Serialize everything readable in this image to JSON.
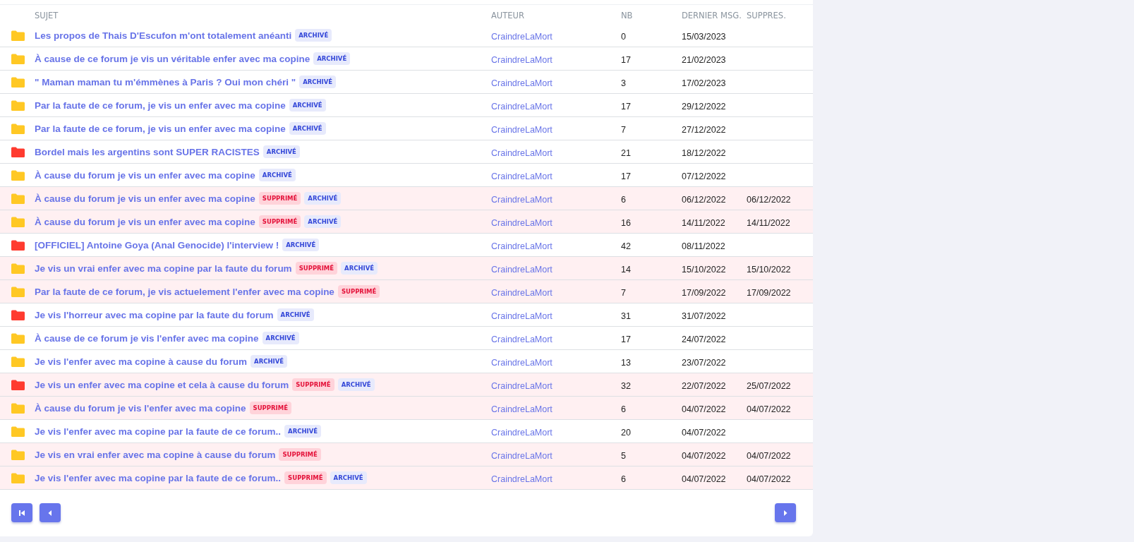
{
  "table": {
    "columns": [
      "SUJET",
      "AUTEUR",
      "NB",
      "DERNIER MSG.",
      "SUPPRES."
    ],
    "rows": [
      {
        "color": "#ffc824",
        "subject": "Les propos de Thais D'Escufon m'ont totalement anéanti",
        "deleted": false,
        "tags": [
          {
            "label": "ARCHIVÉ",
            "kind": "archived"
          }
        ],
        "author": "CraindreLaMort",
        "nb": "0",
        "last": "15/03/2023"
      },
      {
        "color": "#ffc824",
        "subject": "À cause de ce forum je vis un véritable enfer avec ma copine",
        "deleted": false,
        "tags": [
          {
            "label": "ARCHIVÉ",
            "kind": "archived"
          }
        ],
        "author": "CraindreLaMort",
        "nb": "17",
        "last": "21/02/2023"
      },
      {
        "color": "#ffc824",
        "subject": "\" Maman maman tu m'émmènes à Paris ? Oui mon chéri \"",
        "deleted": false,
        "tags": [
          {
            "label": "ARCHIVÉ",
            "kind": "archived"
          }
        ],
        "author": "CraindreLaMort",
        "nb": "3",
        "last": "17/02/2023"
      },
      {
        "color": "#ffc824",
        "subject": "Par la faute de ce forum, je vis un enfer avec ma copine",
        "deleted": false,
        "tags": [
          {
            "label": "ARCHIVÉ",
            "kind": "archived"
          }
        ],
        "author": "CraindreLaMort",
        "nb": "17",
        "last": "29/12/2022"
      },
      {
        "color": "#ffc824",
        "subject": "Par la faute de ce forum, je vis un enfer avec ma copine",
        "deleted": false,
        "tags": [
          {
            "label": "ARCHIVÉ",
            "kind": "archived"
          }
        ],
        "author": "CraindreLaMort",
        "nb": "7",
        "last": "27/12/2022"
      },
      {
        "color": "#ff3b2f",
        "subject": "Bordel mais les argentins sont SUPER RACISTES",
        "deleted": false,
        "tags": [
          {
            "label": "ARCHIVÉ",
            "kind": "archived"
          }
        ],
        "author": "CraindreLaMort",
        "nb": "21",
        "last": "18/12/2022"
      },
      {
        "color": "#ffc824",
        "subject": "À cause du forum je vis un enfer avec ma copine",
        "deleted": false,
        "tags": [
          {
            "label": "ARCHIVÉ",
            "kind": "archived"
          }
        ],
        "author": "CraindreLaMort",
        "nb": "17",
        "last": "07/12/2022"
      },
      {
        "color": "#ffc824",
        "subject": "À cause du forum je vis un enfer avec ma copine",
        "deleted": true,
        "tags": [
          {
            "label": "SUPPRIMÉ",
            "kind": "deleted"
          },
          {
            "label": "ARCHIVÉ",
            "kind": "archived"
          }
        ],
        "author": "CraindreLaMort",
        "nb": "6",
        "last": "06/12/2022",
        "deleted_on": "06/12/2022"
      },
      {
        "color": "#ffc824",
        "subject": "À cause du forum je vis un enfer avec ma copine",
        "deleted": true,
        "tags": [
          {
            "label": "SUPPRIMÉ",
            "kind": "deleted"
          },
          {
            "label": "ARCHIVÉ",
            "kind": "archived"
          }
        ],
        "author": "CraindreLaMort",
        "nb": "16",
        "last": "14/11/2022",
        "deleted_on": "14/11/2022"
      },
      {
        "color": "#ff3b2f",
        "subject": "[OFFICIEL] Antoine Goya (Anal Genocide) l'interview !",
        "deleted": false,
        "tags": [
          {
            "label": "ARCHIVÉ",
            "kind": "archived"
          }
        ],
        "author": "CraindreLaMort",
        "nb": "42",
        "last": "08/11/2022"
      },
      {
        "color": "#ffc824",
        "subject": "Je vis un vrai enfer avec ma copine par la faute du forum",
        "deleted": true,
        "tags": [
          {
            "label": "SUPPRIMÉ",
            "kind": "deleted"
          },
          {
            "label": "ARCHIVÉ",
            "kind": "archived"
          }
        ],
        "author": "CraindreLaMort",
        "nb": "14",
        "last": "15/10/2022",
        "deleted_on": "15/10/2022"
      },
      {
        "color": "#ffc824",
        "subject": "Par la faute de ce forum, je vis actuelement l'enfer avec ma copine",
        "deleted": true,
        "tags": [
          {
            "label": "SUPPRIMÉ",
            "kind": "deleted"
          }
        ],
        "author": "CraindreLaMort",
        "nb": "7",
        "last": "17/09/2022",
        "deleted_on": "17/09/2022"
      },
      {
        "color": "#ff3b2f",
        "subject": "Je vis l'horreur avec ma copine par la faute du forum",
        "deleted": false,
        "tags": [
          {
            "label": "ARCHIVÉ",
            "kind": "archived"
          }
        ],
        "author": "CraindreLaMort",
        "nb": "31",
        "last": "31/07/2022"
      },
      {
        "color": "#ffc824",
        "subject": "À cause de ce forum je vis l'enfer avec ma copine",
        "deleted": false,
        "tags": [
          {
            "label": "ARCHIVÉ",
            "kind": "archived"
          }
        ],
        "author": "CraindreLaMort",
        "nb": "17",
        "last": "24/07/2022"
      },
      {
        "color": "#ffc824",
        "subject": "Je vis l'enfer avec ma copine à cause du forum",
        "deleted": false,
        "tags": [
          {
            "label": "ARCHIVÉ",
            "kind": "archived"
          }
        ],
        "author": "CraindreLaMort",
        "nb": "13",
        "last": "23/07/2022"
      },
      {
        "color": "#ff3b2f",
        "subject": "Je vis un enfer avec ma copine et cela à cause du forum",
        "deleted": true,
        "tags": [
          {
            "label": "SUPPRIMÉ",
            "kind": "deleted"
          },
          {
            "label": "ARCHIVÉ",
            "kind": "archived"
          }
        ],
        "author": "CraindreLaMort",
        "nb": "32",
        "last": "22/07/2022",
        "deleted_on": "25/07/2022"
      },
      {
        "color": "#ffc824",
        "subject": "À cause du forum je vis l'enfer avec ma copine",
        "deleted": true,
        "tags": [
          {
            "label": "SUPPRIMÉ",
            "kind": "deleted"
          }
        ],
        "author": "CraindreLaMort",
        "nb": "6",
        "last": "04/07/2022",
        "deleted_on": "04/07/2022"
      },
      {
        "color": "#ffc824",
        "subject": "Je vis l'enfer avec ma copine par la faute de ce forum..",
        "deleted": false,
        "tags": [
          {
            "label": "ARCHIVÉ",
            "kind": "archived"
          }
        ],
        "author": "CraindreLaMort",
        "nb": "20",
        "last": "04/07/2022"
      },
      {
        "color": "#ffc824",
        "subject": "Je vis en vrai enfer avec ma copine à cause du forum",
        "deleted": true,
        "tags": [
          {
            "label": "SUPPRIMÉ",
            "kind": "deleted"
          }
        ],
        "author": "CraindreLaMort",
        "nb": "5",
        "last": "04/07/2022",
        "deleted_on": "04/07/2022"
      },
      {
        "color": "#ffc824",
        "subject": "Je vis l'enfer avec ma copine par la faute de ce forum..",
        "deleted": true,
        "tags": [
          {
            "label": "SUPPRIMÉ",
            "kind": "deleted"
          },
          {
            "label": "ARCHIVÉ",
            "kind": "archived"
          }
        ],
        "author": "CraindreLaMort",
        "nb": "6",
        "last": "04/07/2022",
        "deleted_on": "04/07/2022"
      }
    ]
  }
}
